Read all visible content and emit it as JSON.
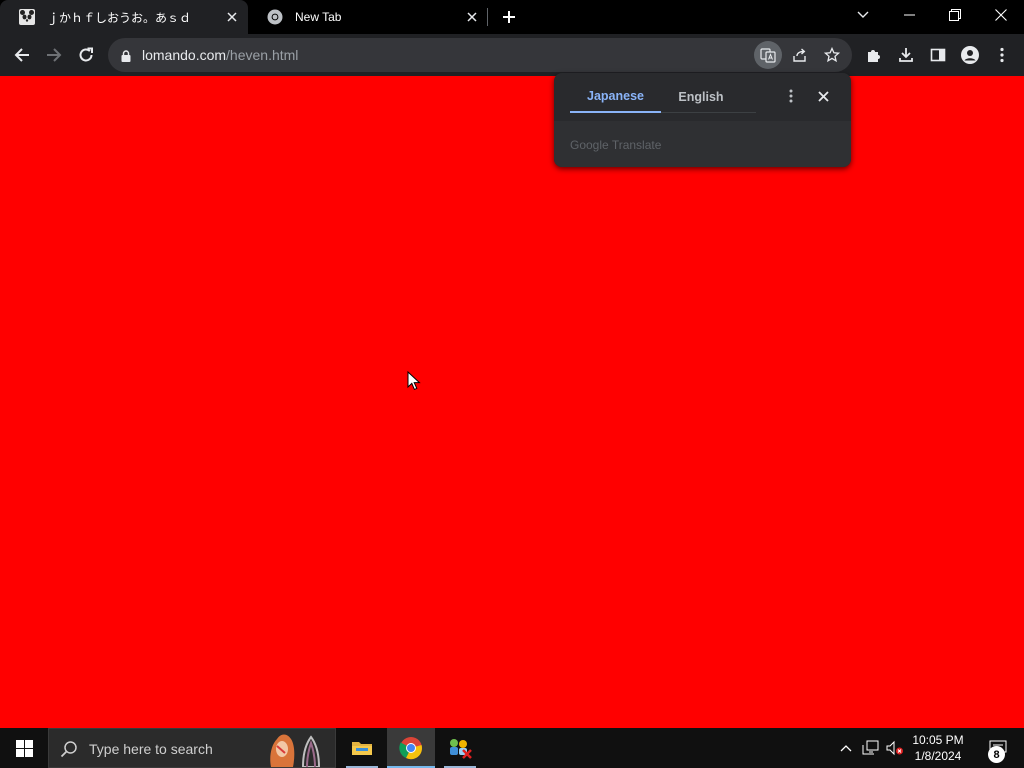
{
  "browser": {
    "tabs": [
      {
        "title": "ｊかｈｆしおうお。あｓｄ",
        "favicon": "panda-favicon-icon",
        "active": true
      },
      {
        "title": "New Tab",
        "favicon": "chrome-icon",
        "active": false
      }
    ],
    "address_bar": {
      "host": "lomando.com",
      "path": "/heven.html"
    }
  },
  "page": {
    "background_color": "#ff0000"
  },
  "translate_bubble": {
    "source_language": "Japanese",
    "target_language": "English",
    "provider_label": "Google Translate"
  },
  "taskbar": {
    "search_placeholder": "Type here to search",
    "apps": [
      "file-explorer-icon",
      "chrome-icon",
      "network-app-icon"
    ],
    "clock": {
      "time": "10:05 PM",
      "date": "1/8/2024"
    },
    "notification_count": "8"
  },
  "colors": {
    "accent_blue": "#8ab4f8",
    "toolbar": "#202124",
    "omnibox": "#35363a"
  }
}
